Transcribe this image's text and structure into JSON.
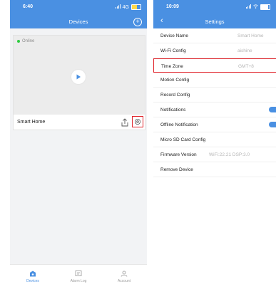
{
  "left": {
    "status": {
      "time": "6:40",
      "signal": "4G",
      "battery_level": 0.55
    },
    "nav": {
      "title": "Devices",
      "add_icon": "plus-circle-icon"
    },
    "device": {
      "status": "Online",
      "name": "Smart Home",
      "status_color": "#2ecc40"
    },
    "tabs": [
      {
        "label": "Devices",
        "icon": "camera-icon",
        "active": true
      },
      {
        "label": "Alarm Log",
        "icon": "log-icon",
        "active": false
      },
      {
        "label": "Account",
        "icon": "account-icon",
        "active": false
      }
    ]
  },
  "right": {
    "status": {
      "time": "10:09"
    },
    "nav": {
      "title": "Settings",
      "back_icon": "chevron-left-icon"
    },
    "rows": [
      {
        "label": "Device Name",
        "value": "Smart Home"
      },
      {
        "label": "Wi-Fi Config",
        "value": "aishine"
      },
      {
        "label": "Time Zone",
        "value": "GMT+8"
      },
      {
        "label": "Motion Config",
        "value": ""
      },
      {
        "label": "Record Config",
        "value": ""
      },
      {
        "label": "Notifications",
        "toggle": true
      },
      {
        "label": "Offline Notification",
        "toggle": true
      },
      {
        "label": "Micro SD Card Config",
        "value": ""
      },
      {
        "label": "Firmware Version",
        "value": "WiFi:22.21 DSP:3.0"
      },
      {
        "label": "Remove Device",
        "value": ""
      }
    ]
  },
  "colors": {
    "accent": "#4a90e2",
    "highlight": "#e0242b"
  }
}
